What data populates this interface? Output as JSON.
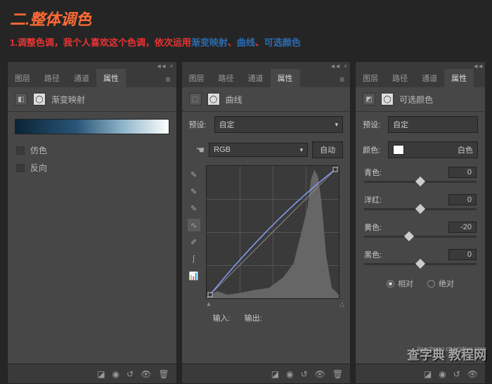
{
  "header": {
    "title": "二.整体调色",
    "subtitle_pre": "1.调整色调，我个人喜欢这个色调，依次运用",
    "t1": "渐变映射",
    "sep": "、",
    "t2": "曲线",
    "t3": "可选颜色"
  },
  "tabs": {
    "layers": "图层",
    "paths": "路径",
    "channels": "通道",
    "properties": "属性"
  },
  "panel1": {
    "name": "渐变映射",
    "opt1": "仿色",
    "opt2": "反向"
  },
  "panel2": {
    "name": "曲线",
    "preset_label": "预设:",
    "preset_value": "自定",
    "channel": "RGB",
    "auto": "自动",
    "input_label": "输入:",
    "output_label": "输出:"
  },
  "panel3": {
    "name": "可选颜色",
    "preset_label": "预设:",
    "preset_value": "自定",
    "color_label": "颜色:",
    "color_value": "白色",
    "sliders": [
      {
        "label": "青色:",
        "value": "0",
        "pos": 50
      },
      {
        "label": "洋红:",
        "value": "0",
        "pos": 50
      },
      {
        "label": "黄色:",
        "value": "-20",
        "pos": 40
      },
      {
        "label": "黑色:",
        "value": "0",
        "pos": 50
      }
    ],
    "relative": "相对",
    "absolute": "绝对"
  },
  "watermark": {
    "main": "查字典 教程网",
    "url": "jiaocheng.chazidian.com"
  }
}
